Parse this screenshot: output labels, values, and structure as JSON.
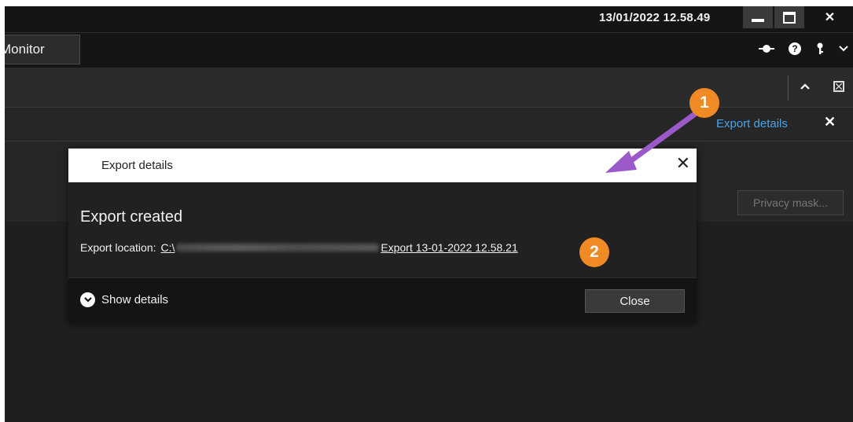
{
  "titlebar": {
    "clock": "13/01/2022 12.58.49",
    "minimize_icon": "minimize-icon",
    "maximize_icon": "maximize-icon",
    "close_glyph": "✕"
  },
  "tabs": {
    "monitor_label": "Monitor"
  },
  "header_icons": {
    "connection_icon": "connection-icon",
    "help_glyph": "?",
    "key_glyph": "⚲",
    "menu_glyph": "⌄"
  },
  "toolbar": {
    "collapse_glyph": "⌃",
    "fit_glyph": "⊠"
  },
  "panel": {
    "export_details_link": "Export details",
    "close_glyph": "✕"
  },
  "content": {
    "privacy_mask_label": "Privacy mask..."
  },
  "dialog": {
    "title": "Export details",
    "close_glyph": "✕",
    "heading": "Export created",
    "location_label": "Export location:",
    "location_path_prefix": "C:\\",
    "location_file": "Export 13-01-2022 12.58.21",
    "show_details_label": "Show details",
    "show_details_glyph": "⌄",
    "close_button_label": "Close"
  },
  "callouts": {
    "first": "1",
    "second": "2"
  },
  "colors": {
    "accent_link": "#4ba3e6",
    "callout": "#f08a24",
    "arrow": "#9b59c9"
  }
}
